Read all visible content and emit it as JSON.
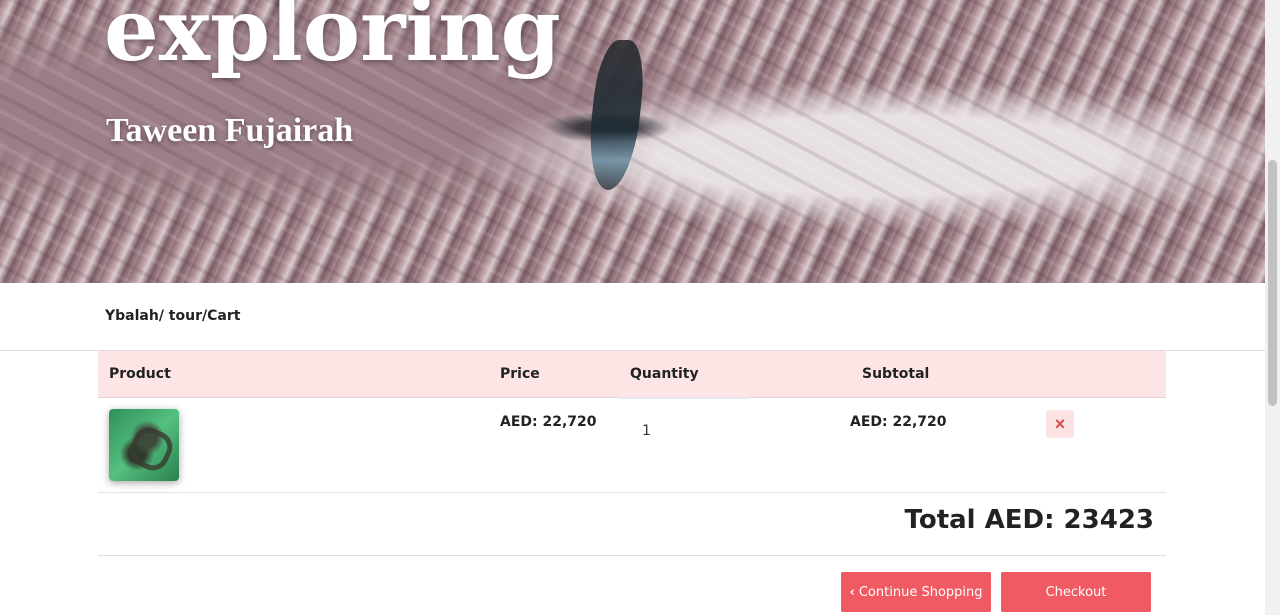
{
  "hero": {
    "title": "exploring",
    "subtitle": "Taween Fujairah"
  },
  "breadcrumb": "Ybalah/ tour/Cart",
  "table": {
    "headers": {
      "product": "Product",
      "price": "Price",
      "quantity": "Quantity",
      "subtotal": "Subtotal"
    },
    "rows": [
      {
        "price": "AED: 22,720",
        "quantity": "1",
        "subtotal": "AED: 22,720",
        "remove_label": "×"
      }
    ]
  },
  "total": "Total AED: 23423",
  "buttons": {
    "continue_label": "Continue Shopping",
    "continue_icon": "‹",
    "checkout_label": "Checkout"
  },
  "colors": {
    "accent": "#ef5a63",
    "header_bg": "#fde5e6"
  }
}
